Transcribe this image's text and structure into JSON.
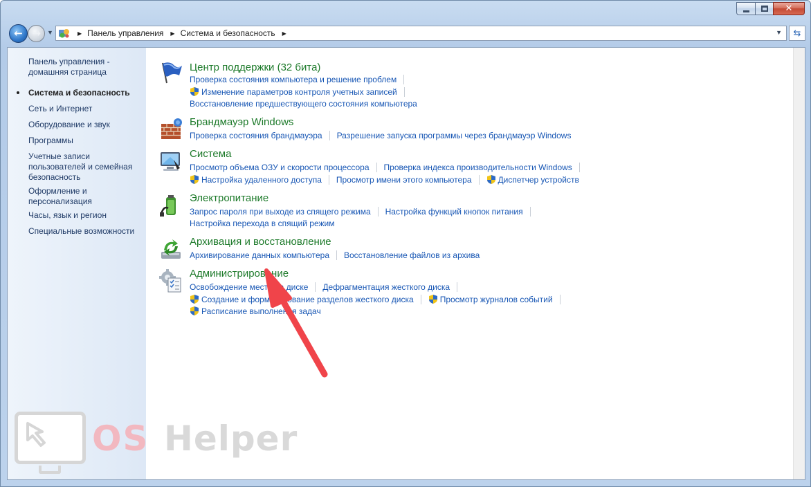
{
  "window": {
    "caption_buttons": {
      "minimize": "minimize",
      "maximize": "maximize",
      "close": "✕"
    }
  },
  "navbar": {
    "back_icon": "back-arrow-icon",
    "forward_icon": "forward-arrow-icon",
    "breadcrumb": [
      "Панель управления",
      "Система и безопасность"
    ],
    "refresh_icon": "refresh-icon"
  },
  "sidebar": {
    "items": [
      {
        "label": "Панель управления - домашняя страница",
        "active": false
      },
      {
        "label": "Система и безопасность",
        "active": true
      },
      {
        "label": "Сеть и Интернет",
        "active": false
      },
      {
        "label": "Оборудование и звук",
        "active": false
      },
      {
        "label": "Программы",
        "active": false
      },
      {
        "label": "Учетные записи пользователей и семейная безопасность",
        "active": false
      },
      {
        "label": "Оформление и персонализация",
        "active": false
      },
      {
        "label": "Часы, язык и регион",
        "active": false
      },
      {
        "label": "Специальные возможности",
        "active": false
      }
    ]
  },
  "categories": [
    {
      "title": "Центр поддержки (32 бита)",
      "icon": "flag-icon",
      "rows": [
        [
          {
            "label": "Проверка состояния компьютера и решение проблем",
            "shield": false
          }
        ],
        [
          {
            "label": "Изменение параметров контроля учетных записей",
            "shield": true
          }
        ],
        [
          {
            "label": "Восстановление предшествующего состояния компьютера",
            "shield": false
          }
        ]
      ]
    },
    {
      "title": "Брандмауэр Windows",
      "icon": "firewall-icon",
      "rows": [
        [
          {
            "label": "Проверка состояния брандмауэра",
            "shield": false
          },
          {
            "label": "Разрешение запуска программы через брандмауэр Windows",
            "shield": false
          }
        ]
      ]
    },
    {
      "title": "Система",
      "icon": "computer-icon",
      "rows": [
        [
          {
            "label": "Просмотр объема ОЗУ и скорости процессора",
            "shield": false
          },
          {
            "label": "Проверка индекса производительности Windows",
            "shield": false
          }
        ],
        [
          {
            "label": "Настройка удаленного доступа",
            "shield": true
          },
          {
            "label": "Просмотр имени этого компьютера",
            "shield": false
          },
          {
            "label": "Диспетчер устройств",
            "shield": true
          }
        ]
      ]
    },
    {
      "title": "Электропитание",
      "icon": "power-icon",
      "rows": [
        [
          {
            "label": "Запрос пароля при выходе из спящего режима",
            "shield": false
          },
          {
            "label": "Настройка функций кнопок питания",
            "shield": false
          }
        ],
        [
          {
            "label": "Настройка перехода в спящий режим",
            "shield": false
          }
        ]
      ]
    },
    {
      "title": "Архивация и восстановление",
      "icon": "backup-icon",
      "rows": [
        [
          {
            "label": "Архивирование данных компьютера",
            "shield": false
          },
          {
            "label": "Восстановление файлов из архива",
            "shield": false
          }
        ]
      ]
    },
    {
      "title": "Администрирование",
      "icon": "admin-tools-icon",
      "rows": [
        [
          {
            "label": "Освобождение места на диске",
            "shield": false
          },
          {
            "label": "Дефрагментация жесткого диска",
            "shield": false
          }
        ],
        [
          {
            "label": "Создание и форматирование разделов жесткого диска",
            "shield": true
          },
          {
            "label": "Просмотр журналов событий",
            "shield": true
          }
        ],
        [
          {
            "label": "Расписание выполнения задач",
            "shield": true
          }
        ]
      ]
    }
  ],
  "watermark": {
    "part1": "OS",
    "part2": "Helper"
  },
  "colors": {
    "category_title": "#1d7a2a",
    "task_link": "#1756b4",
    "annotation_arrow": "#f0444a"
  }
}
